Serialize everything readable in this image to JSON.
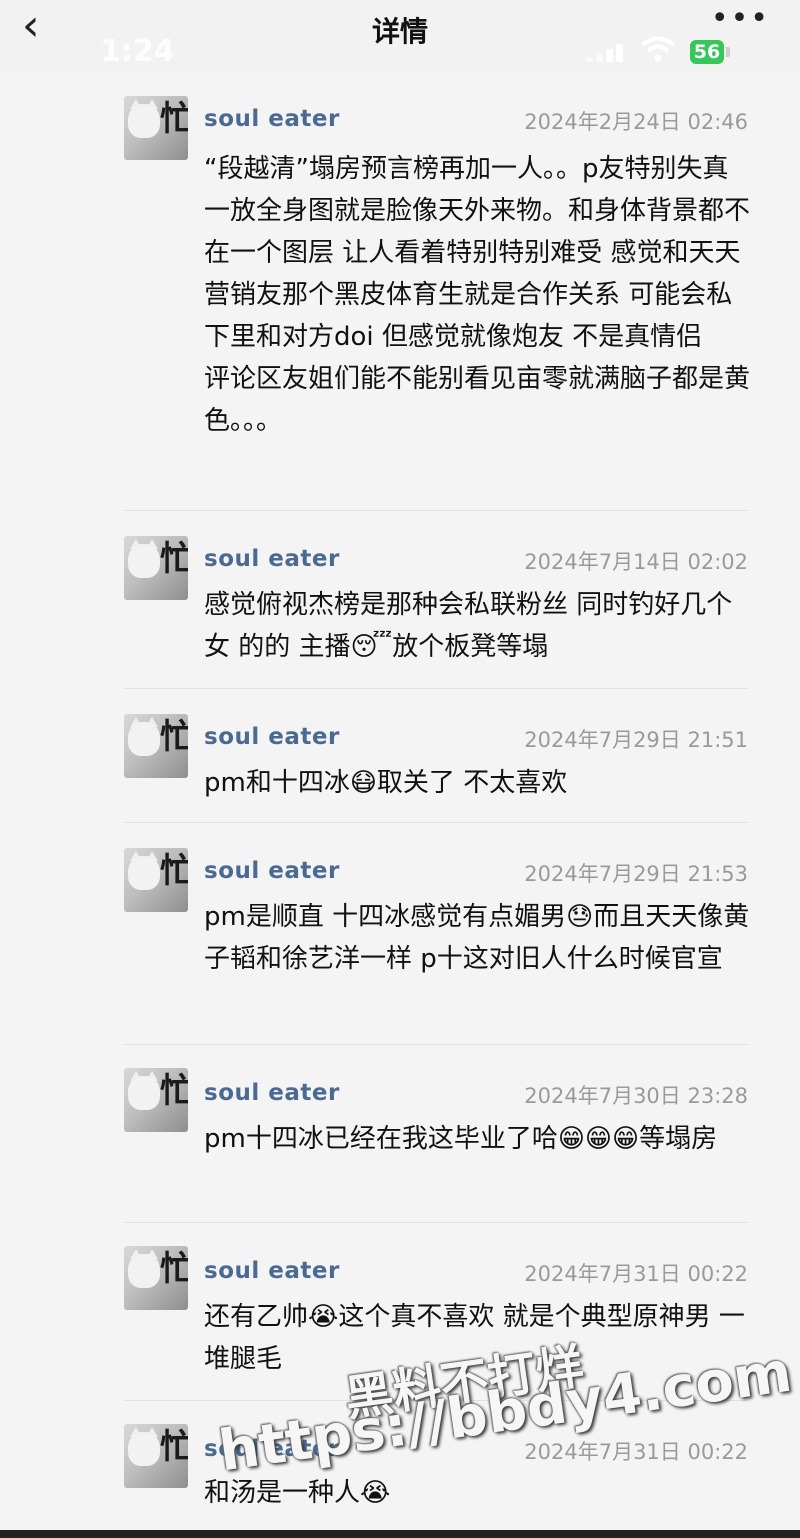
{
  "header": {
    "title": "详情",
    "back_icon": "‹",
    "more_icon": "•••"
  },
  "status_bar": {
    "time": "1:24",
    "battery": "56"
  },
  "comments": [
    {
      "username": "soul  eater",
      "time": "2024年2月24日  02:46",
      "text": "“段越清”塌房预言榜再加一人。。p​友特别失真 一放全身图就是脸像天外来物。和身体背景都不在一个图层 让人看着特别特别难受 感觉和天天营销​友那个黑皮体育生就是合作关系 可能会私下里和对方doi 但感觉就像炮友 不是真情侣\n评论区​友姐们能不能别看见亩零就满脑子都是黄色。。。"
    },
    {
      "username": "soul  eater",
      "time": "2024年7月14日  02:02",
      "text": "感觉俯视杰榜是那种会私联粉丝 同时钓好几个女 的的 主播😴放个板凳等塌"
    },
    {
      "username": "soul  eater",
      "time": "2024年7月29日  21:51",
      "text": "pm和十四冰😷取关了 不太喜欢"
    },
    {
      "username": "soul  eater",
      "time": "2024年7月29日  21:53",
      "text": "pm是顺直 十四冰感觉有点媚男😓而且天天像黄子韬和徐艺洋一样 p十这对旧人什么时候官宣"
    },
    {
      "username": "soul  eater",
      "time": "2024年7月30日  23:28",
      "text": "pm十四冰已经在我这毕业了哈😁😁😁等塌房"
    },
    {
      "username": "soul  eater",
      "time": "2024年7月31日  00:22",
      "text": "还有乙帅😭这个真不喜欢 就是个典型原神男 一堆腿毛"
    },
    {
      "username": "soul  eater",
      "time": "2024年7月31日  00:22",
      "text": "和汤是一种人😭"
    }
  ],
  "watermark": {
    "line1": "黑料不打烊",
    "line2": "https://bbdy4.com"
  }
}
